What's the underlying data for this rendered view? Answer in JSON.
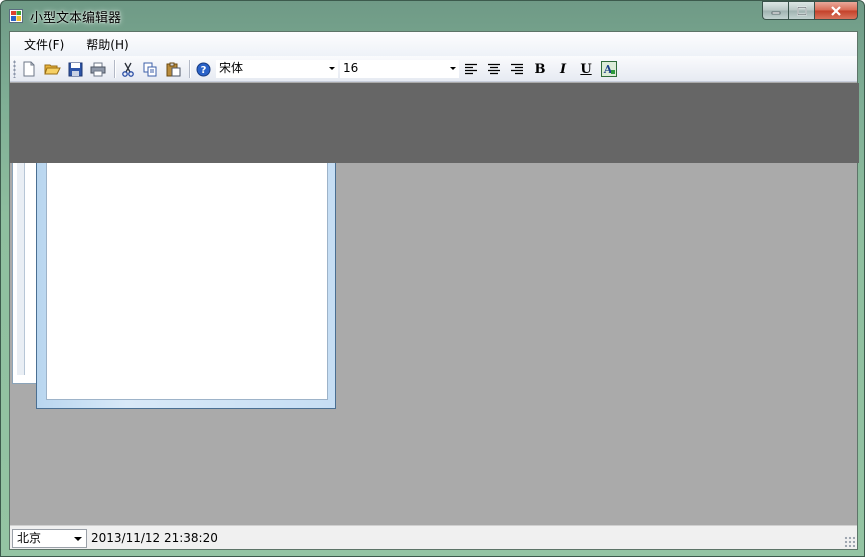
{
  "window": {
    "title": "小型文本编辑器"
  },
  "menu": {
    "items": [
      {
        "label": "文件(F)"
      },
      {
        "label": "帮助(H)"
      }
    ]
  },
  "toolbar": {
    "buttons": [
      {
        "name": "new-icon"
      },
      {
        "name": "open-folder-icon"
      },
      {
        "name": "save-icon"
      },
      {
        "name": "print-icon"
      },
      {
        "name": "cut-icon"
      },
      {
        "name": "copy-icon"
      },
      {
        "name": "paste-icon"
      },
      {
        "name": "help-icon"
      }
    ],
    "font_name": "宋体",
    "font_size": "16",
    "format_buttons": [
      {
        "name": "align-left-icon"
      },
      {
        "name": "align-center-icon"
      },
      {
        "name": "align-right-icon"
      },
      {
        "name": "bold-button",
        "label": "B"
      },
      {
        "name": "italic-button",
        "label": "I"
      },
      {
        "name": "underline-button",
        "label": "U"
      },
      {
        "name": "font-color-icon"
      }
    ]
  },
  "statusbar": {
    "city": "北京",
    "datetime": "2013/11/12 21:38:20"
  },
  "colors": {
    "mdi_background": "#aaaaaa",
    "dark_band": "#666666",
    "close_button": "#c4412a"
  }
}
